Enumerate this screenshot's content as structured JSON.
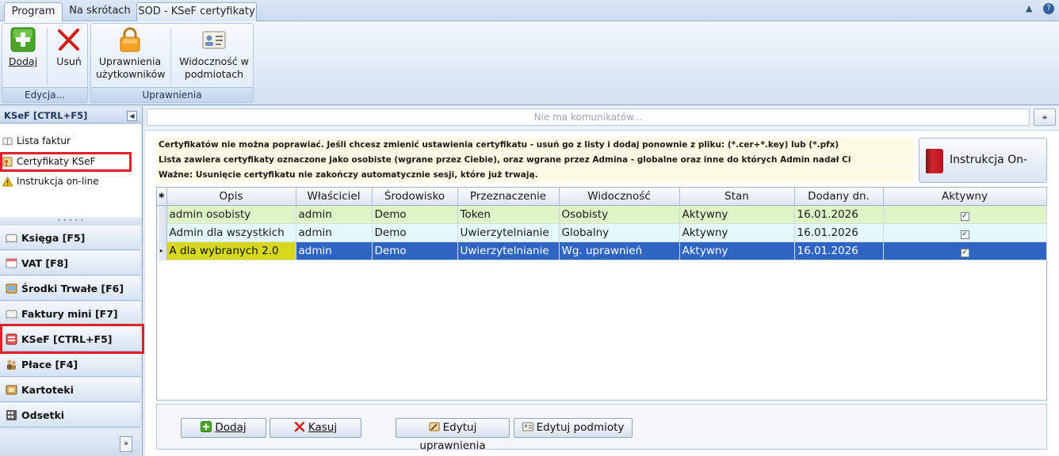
{
  "tabs": [
    {
      "label": "Program"
    },
    {
      "label": "Na skrótach"
    },
    {
      "label": "SOD - KSeF certyfikaty"
    }
  ],
  "ribbon": {
    "groups": [
      {
        "label": "Edycja..."
      },
      {
        "label": "Uprawnienia"
      }
    ],
    "buttons": {
      "add": "Dodaj",
      "remove": "Usuń",
      "user_permissions_l1": "Uprawnienia",
      "user_permissions_l2": "użytkowników",
      "visibility_l1": "Widoczność w",
      "visibility_l2": "podmiotach"
    }
  },
  "nav": {
    "header": "KSeF [CTRL+F5]",
    "items": [
      {
        "label": "Lista faktur"
      },
      {
        "label": "Certyfikaty KSeF"
      },
      {
        "label": "Instrukcja on-line"
      }
    ],
    "modules": [
      {
        "label": "Księga [F5]"
      },
      {
        "label": "VAT [F8]"
      },
      {
        "label": "Środki Trwałe [F6]"
      },
      {
        "label": "Faktury mini [F7]"
      },
      {
        "label": "KSeF [CTRL+F5]"
      },
      {
        "label": "Płace [F4]"
      },
      {
        "label": "Kartoteki"
      },
      {
        "label": "Odsetki"
      }
    ]
  },
  "messages": {
    "text": "Nie ma komunikatów..."
  },
  "info": {
    "line1": "Certyfikatów nie można poprawiać. Jeśli chcesz zmienić ustawienia certyfikatu - usuń go z listy i dodaj ponownie z pliku: (*.cer+*.key) lub (*.pfx)",
    "line2": "Lista zawiera certyfikaty oznaczone jako osobiste (wgrane przez Ciebie), oraz wgrane przez Admina - globalne oraz inne do których Admin nadał Ci Uprawnienia.",
    "line3": "Ważne: Usunięcie certyfikatu nie zakończy automatycznie sesji, które już trwają."
  },
  "instruction_button": "Instrukcja On-Line",
  "grid": {
    "columns": [
      "Opis",
      "Właściciel",
      "Środowisko",
      "Przeznaczenie",
      "Widoczność",
      "Stan",
      "Dodany dn.",
      "Aktywny"
    ],
    "rows": [
      {
        "opis": "admin osobisty",
        "wlasciciel": "admin",
        "srodowisko": "Demo",
        "przeznaczenie": "Token",
        "widocznosc": "Osobisty",
        "stan": "Aktywny",
        "dodany": "16.01.2026",
        "aktywny": true
      },
      {
        "opis": "Admin dla wszystkich",
        "wlasciciel": "admin",
        "srodowisko": "Demo",
        "przeznaczenie": "Uwierzytelnianie",
        "widocznosc": "Globalny",
        "stan": "Aktywny",
        "dodany": "16.01.2026",
        "aktywny": true
      },
      {
        "opis": "A dla wybranych 2.0",
        "wlasciciel": "admin",
        "srodowisko": "Demo",
        "przeznaczenie": "Uwierzytelnianie",
        "widocznosc": "Wg. uprawnień",
        "stan": "Aktywny",
        "dodany": "16.01.2026",
        "aktywny": true
      }
    ]
  },
  "panel_buttons": {
    "add": "Dodaj",
    "delete": "Kasuj",
    "edit_permissions": "Edytuj uprawnienia",
    "edit_entities": "Edytuj podmioty"
  },
  "colors": {
    "highlight_frame": "#e0202b",
    "selected_row": "#2f65c2",
    "current_cell": "#d7d81c",
    "row_personal": "#dcf4c6",
    "row_global": "#e4f8fa",
    "info_bg": "#fdfbe3"
  }
}
